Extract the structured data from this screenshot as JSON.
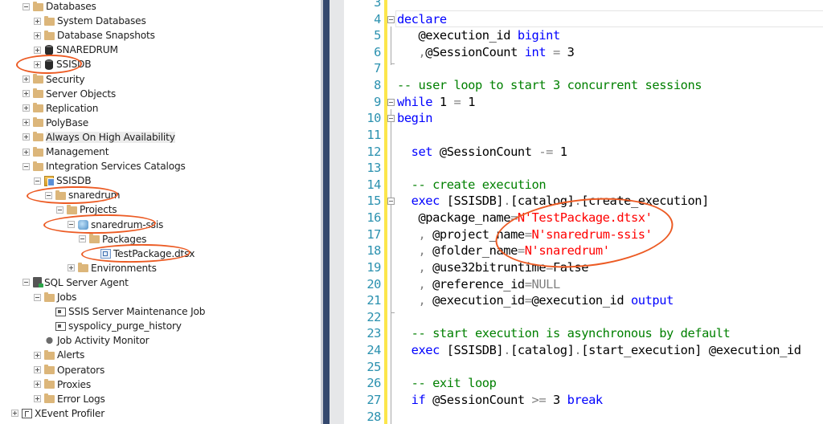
{
  "object_explorer": {
    "nodes": [
      {
        "label": "Databases",
        "expander": "minus",
        "icon": "folder-icon"
      },
      {
        "label": "System Databases",
        "expander": "plus",
        "icon": "folder-icon"
      },
      {
        "label": "Database Snapshots",
        "expander": "plus",
        "icon": "folder-icon"
      },
      {
        "label": "SNAREDRUM",
        "expander": "plus",
        "icon": "database-icon"
      },
      {
        "label": "SSISDB",
        "expander": "plus",
        "icon": "database-icon",
        "annotated": true
      },
      {
        "label": "Security",
        "expander": "plus",
        "icon": "folder-icon"
      },
      {
        "label": "Server Objects",
        "expander": "plus",
        "icon": "folder-icon"
      },
      {
        "label": "Replication",
        "expander": "plus",
        "icon": "folder-icon"
      },
      {
        "label": "PolyBase",
        "expander": "plus",
        "icon": "folder-icon"
      },
      {
        "label": "Always On High Availability",
        "expander": "plus",
        "icon": "folder-icon",
        "highlighted": true
      },
      {
        "label": "Management",
        "expander": "plus",
        "icon": "folder-icon"
      },
      {
        "label": "Integration Services Catalogs",
        "expander": "minus",
        "icon": "folder-icon"
      },
      {
        "label": "SSISDB",
        "expander": "minus",
        "icon": "catalog-icon"
      },
      {
        "label": "snaredrum",
        "expander": "minus",
        "icon": "folder-icon",
        "annotated": true
      },
      {
        "label": "Projects",
        "expander": "minus",
        "icon": "folder-icon"
      },
      {
        "label": "snaredrum-ssis",
        "expander": "minus",
        "icon": "project-icon",
        "annotated": true
      },
      {
        "label": "Packages",
        "expander": "minus",
        "icon": "folder-icon"
      },
      {
        "label": "TestPackage.dtsx",
        "expander": "none",
        "icon": "package-icon",
        "annotated": true
      },
      {
        "label": "Environments",
        "expander": "plus",
        "icon": "folder-icon"
      },
      {
        "label": "SQL Server Agent",
        "expander": "minus",
        "icon": "agent-icon"
      },
      {
        "label": "Jobs",
        "expander": "minus",
        "icon": "folder-icon"
      },
      {
        "label": "SSIS Server Maintenance Job",
        "expander": "none",
        "icon": "job-icon"
      },
      {
        "label": "syspolicy_purge_history",
        "expander": "none",
        "icon": "job-icon"
      },
      {
        "label": "Job Activity Monitor",
        "expander": "none",
        "icon": "job-activity-monitor-icon"
      },
      {
        "label": "Alerts",
        "expander": "plus",
        "icon": "folder-icon"
      },
      {
        "label": "Operators",
        "expander": "plus",
        "icon": "folder-icon"
      },
      {
        "label": "Proxies",
        "expander": "plus",
        "icon": "folder-icon"
      },
      {
        "label": "Error Logs",
        "expander": "plus",
        "icon": "folder-icon"
      },
      {
        "label": "XEvent Profiler",
        "expander": "plus",
        "icon": "xevent-profiler-icon"
      }
    ]
  },
  "editor": {
    "lines": [
      {
        "num": "3",
        "tokens": []
      },
      {
        "num": "4",
        "fold": true,
        "tokens": [
          {
            "t": "declare",
            "c": "kw"
          }
        ]
      },
      {
        "num": "5",
        "tokens": [
          {
            "t": "   @execution_id ",
            "c": ""
          },
          {
            "t": "bigint",
            "c": "kw"
          }
        ]
      },
      {
        "num": "6",
        "tokens": [
          {
            "t": "   ",
            "c": ""
          },
          {
            "t": ",",
            "c": "gy"
          },
          {
            "t": "@SessionCount ",
            "c": ""
          },
          {
            "t": "int",
            "c": "kw"
          },
          {
            "t": " = ",
            "c": "op"
          },
          {
            "t": "3",
            "c": ""
          }
        ]
      },
      {
        "num": "7",
        "tokens": []
      },
      {
        "num": "8",
        "tokens": [
          {
            "t": "-- user loop to start 3 concurrent sessions",
            "c": "cm"
          }
        ]
      },
      {
        "num": "9",
        "fold": true,
        "tokens": [
          {
            "t": "while",
            "c": "kw"
          },
          {
            "t": " 1 ",
            "c": ""
          },
          {
            "t": "=",
            "c": "op"
          },
          {
            "t": " 1",
            "c": ""
          }
        ]
      },
      {
        "num": "10",
        "fold": true,
        "tokens": [
          {
            "t": "begin",
            "c": "kw"
          }
        ]
      },
      {
        "num": "11",
        "tokens": []
      },
      {
        "num": "12",
        "tokens": [
          {
            "t": "  ",
            "c": ""
          },
          {
            "t": "set",
            "c": "kw"
          },
          {
            "t": " @SessionCount ",
            "c": ""
          },
          {
            "t": "-=",
            "c": "op"
          },
          {
            "t": " 1",
            "c": ""
          }
        ]
      },
      {
        "num": "13",
        "tokens": []
      },
      {
        "num": "14",
        "tokens": [
          {
            "t": "  -- create execution",
            "c": "cm"
          }
        ]
      },
      {
        "num": "15",
        "fold": true,
        "tokens": [
          {
            "t": "  ",
            "c": ""
          },
          {
            "t": "exec",
            "c": "kw"
          },
          {
            "t": " [SSISDB]",
            "c": ""
          },
          {
            "t": ".",
            "c": "gy"
          },
          {
            "t": "[catalog]",
            "c": ""
          },
          {
            "t": ".",
            "c": "gy"
          },
          {
            "t": "[create_execution]",
            "c": ""
          }
        ]
      },
      {
        "num": "16",
        "tokens": [
          {
            "t": "   @package_name",
            "c": ""
          },
          {
            "t": "=",
            "c": "op"
          },
          {
            "t": "N'TestPackage.dtsx'",
            "c": "st"
          }
        ]
      },
      {
        "num": "17",
        "tokens": [
          {
            "t": "   ",
            "c": ""
          },
          {
            "t": ",",
            "c": "gy"
          },
          {
            "t": " @project_name",
            "c": ""
          },
          {
            "t": "=",
            "c": "op"
          },
          {
            "t": "N'snaredrum-ssis'",
            "c": "st"
          }
        ]
      },
      {
        "num": "18",
        "tokens": [
          {
            "t": "   ",
            "c": ""
          },
          {
            "t": ",",
            "c": "gy"
          },
          {
            "t": " @folder_name",
            "c": ""
          },
          {
            "t": "=",
            "c": "op"
          },
          {
            "t": "N'snaredrum'",
            "c": "st"
          }
        ]
      },
      {
        "num": "19",
        "tokens": [
          {
            "t": "   ",
            "c": ""
          },
          {
            "t": ",",
            "c": "gy"
          },
          {
            "t": " @use32bitruntime",
            "c": ""
          },
          {
            "t": "=",
            "c": "op"
          },
          {
            "t": "False",
            "c": ""
          }
        ]
      },
      {
        "num": "20",
        "tokens": [
          {
            "t": "   ",
            "c": ""
          },
          {
            "t": ",",
            "c": "gy"
          },
          {
            "t": " @reference_id",
            "c": ""
          },
          {
            "t": "=",
            "c": "op"
          },
          {
            "t": "NULL",
            "c": "gy"
          }
        ]
      },
      {
        "num": "21",
        "tokens": [
          {
            "t": "   ",
            "c": ""
          },
          {
            "t": ",",
            "c": "gy"
          },
          {
            "t": " @execution_id",
            "c": ""
          },
          {
            "t": "=",
            "c": "op"
          },
          {
            "t": "@execution_id ",
            "c": ""
          },
          {
            "t": "output",
            "c": "kw"
          }
        ]
      },
      {
        "num": "22",
        "tokens": []
      },
      {
        "num": "23",
        "tokens": [
          {
            "t": "  -- start execution is asynchronous by default",
            "c": "cm"
          }
        ]
      },
      {
        "num": "24",
        "tokens": [
          {
            "t": "  ",
            "c": ""
          },
          {
            "t": "exec",
            "c": "kw"
          },
          {
            "t": " [SSISDB]",
            "c": ""
          },
          {
            "t": ".",
            "c": "gy"
          },
          {
            "t": "[catalog]",
            "c": ""
          },
          {
            "t": ".",
            "c": "gy"
          },
          {
            "t": "[start_execution] @execution_id",
            "c": ""
          }
        ]
      },
      {
        "num": "25",
        "tokens": []
      },
      {
        "num": "26",
        "tokens": [
          {
            "t": "  -- exit loop",
            "c": "cm"
          }
        ]
      },
      {
        "num": "27",
        "tokens": [
          {
            "t": "  ",
            "c": ""
          },
          {
            "t": "if",
            "c": "kw"
          },
          {
            "t": " @SessionCount ",
            "c": ""
          },
          {
            "t": ">=",
            "c": "op"
          },
          {
            "t": " 3 ",
            "c": ""
          },
          {
            "t": "break",
            "c": "kw"
          }
        ]
      },
      {
        "num": "28",
        "tokens": []
      }
    ]
  },
  "colors": {
    "annotation": "#ec5b24",
    "keyword": "#0000ff",
    "comment": "#008000",
    "string": "#ff0000",
    "line_number": "#2b91af",
    "change_bar": "#fce64c",
    "splitter": "#34486e"
  }
}
